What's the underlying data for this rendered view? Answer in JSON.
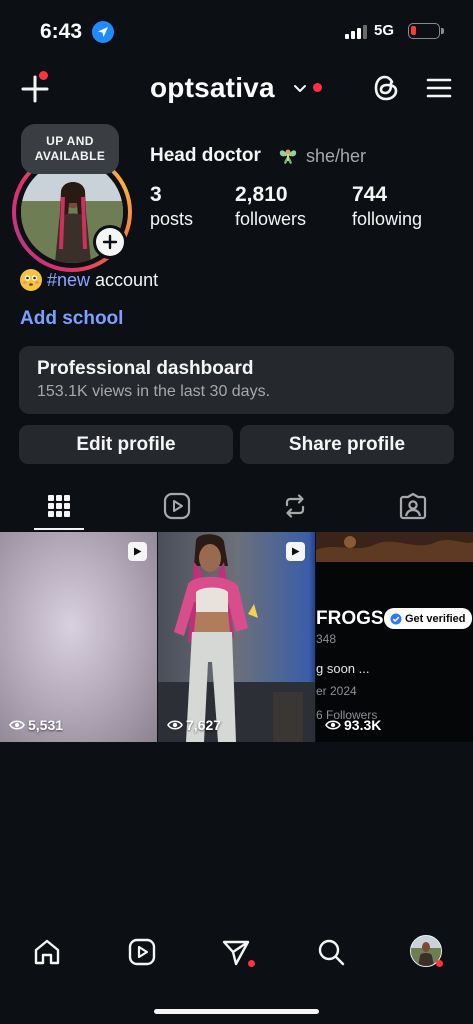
{
  "status_bar": {
    "time": "6:43",
    "network": "5G"
  },
  "header": {
    "username": "optsativa"
  },
  "profile": {
    "note": [
      "UP AND",
      "AVAILABLE"
    ],
    "name": "Head doctor",
    "pronouns": "she/her",
    "stats": [
      {
        "value": "3",
        "label": "posts"
      },
      {
        "value": "2,810",
        "label": "followers"
      },
      {
        "value": "744",
        "label": "following"
      }
    ],
    "bio_hashtag": "#new",
    "bio_text": "account",
    "add_school": "Add school"
  },
  "dashboard": {
    "title": "Professional dashboard",
    "subtitle": "153.1K views in the last 30 days."
  },
  "actions": {
    "edit": "Edit profile",
    "share": "Share profile"
  },
  "tabs": [
    "grid-icon",
    "reels-icon",
    "reposts-icon",
    "tagged-icon"
  ],
  "posts": [
    {
      "views": "5,531",
      "type": "reel"
    },
    {
      "views": "7,627",
      "type": "reel"
    },
    {
      "views": "93.3K",
      "screenshot_text": {
        "heading": "FROGS",
        "verify": "Get verified",
        "count": "348",
        "line1": "g soon ...",
        "line2": "er 2024",
        "followers": "6 Followers"
      }
    }
  ],
  "nav": [
    "home-icon",
    "reels-icon",
    "messages-icon",
    "search-icon",
    "profile-avatar"
  ],
  "colors": {
    "background": "#0c1014",
    "surface": "#25292e",
    "link": "#7ba0ff",
    "hashtag": "#8aa6ff",
    "notify": "#ff3040"
  }
}
